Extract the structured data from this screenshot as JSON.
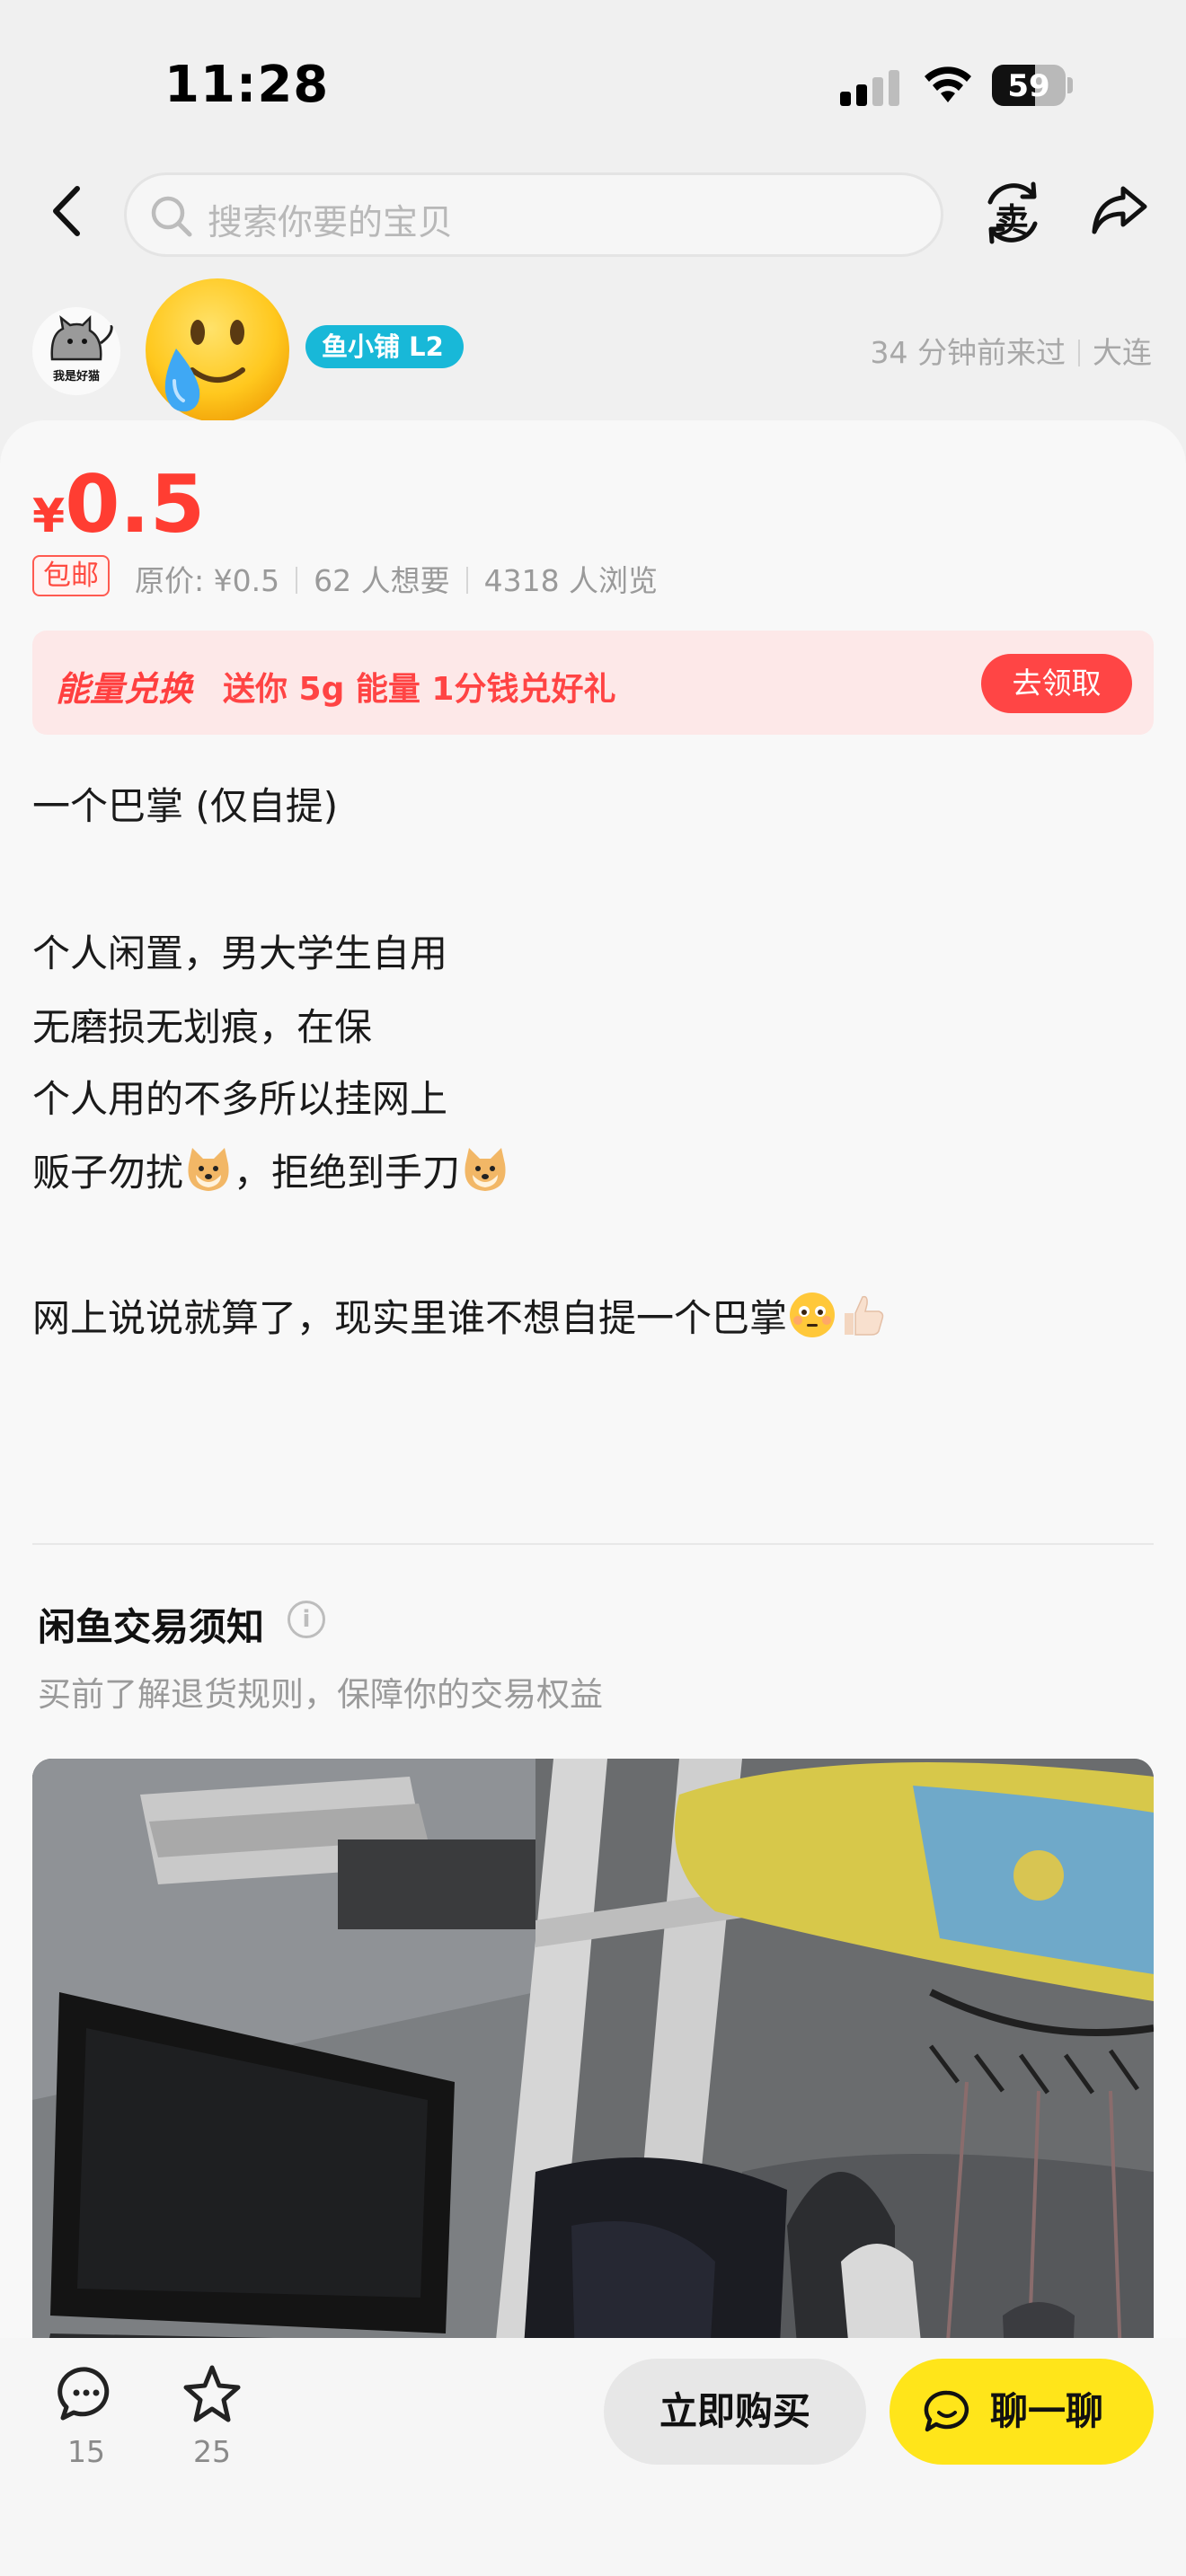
{
  "status_bar": {
    "time": "11:28",
    "battery": "59",
    "battery_level": 0.59
  },
  "search": {
    "placeholder": "搜索你要的宝贝"
  },
  "header": {
    "sell_label": "卖"
  },
  "seller": {
    "avatar_caption": "我是好猫",
    "shop_badge": "鱼小铺 L2",
    "last_seen": "34 分钟前来过",
    "location": "大连"
  },
  "item": {
    "currency": "¥",
    "price": "0.5",
    "free_shipping": "包邮",
    "original_price": "原价: ¥0.5",
    "wants": "62 人想要",
    "views": "4318 人浏览"
  },
  "promo": {
    "title": "能量兑换",
    "text": "送你 5g 能量 1分钱兑好礼",
    "button": "去领取"
  },
  "description": {
    "line1": "一个巴掌 (仅自提)",
    "line2": "个人闲置，男大学生自用",
    "line3": "无磨损无划痕，在保",
    "line4": "个人用的不多所以挂网上",
    "line5a": "贩子勿扰",
    "line5b": "，拒绝到手刀",
    "line6": "网上说说就算了，现实里谁不想自提一个巴掌"
  },
  "notice": {
    "title": "闲鱼交易须知",
    "subtitle": "买前了解退货规则，保障你的交易权益"
  },
  "bottom_bar": {
    "comments": "15",
    "favorites": "25",
    "buy_label": "立即购买",
    "chat_label": "聊一聊"
  },
  "colors": {
    "price_red": "#ff3d32",
    "chat_yellow": "#ffe51a",
    "badge_cyan": "#18b8d8"
  }
}
